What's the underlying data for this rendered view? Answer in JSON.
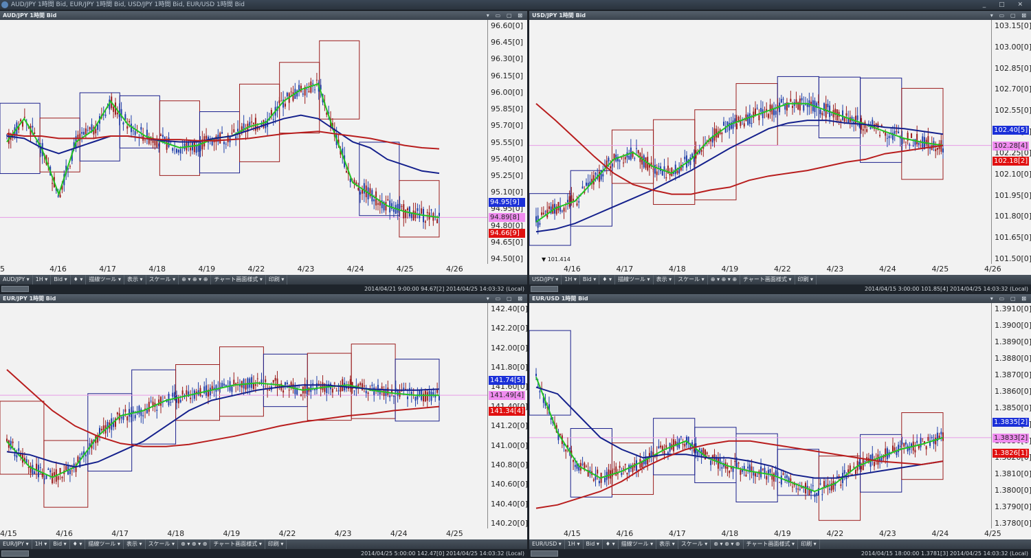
{
  "app": {
    "title": "AUD/JPY 1時間 Bid, EUR/JPY 1時間 Bid, USD/JPY 1時間 Bid, EUR/USD 1時間 Bid",
    "controls": "_ □ ✕"
  },
  "colors": {
    "plot_bg": "#f2f2f2",
    "candle_up": "#1f3fa8",
    "candle_down": "#9b1c1c",
    "ma_short": "#22c322",
    "ma_mid": "#14208c",
    "ma_long": "#b81d1d",
    "box_up": "#1a1f8c",
    "box_down": "#9b1c1c",
    "bid_line": "#e79be7",
    "tag_high": "#1a2fd8",
    "tag_mid": "#f08cf0",
    "tag_low": "#e01010"
  },
  "toolbar_items": [
    "1H ▾",
    "Bid ▾",
    "♦ ▾",
    "描線ツール ▾",
    "表示 ▾",
    "スケール ▾",
    "⊕ ▾ ⊕ ▾ ⊕",
    "チャート画面様式 ▾",
    "印刷 ▾"
  ],
  "panes": [
    {
      "id": "audjpy",
      "title": "AUD/JPY 1時間 Bid",
      "symbol": "AUD/JPY ▾",
      "y_ticks": [
        "96.60[0]",
        "96.45[0]",
        "96.30[0]",
        "96.15[0]",
        "96.00[0]",
        "95.85[0]",
        "95.70[0]",
        "95.55[0]",
        "95.40[0]",
        "95.25[0]",
        "95.10[0]",
        "94.95[0]",
        "94.80[0]",
        "94.65[0]",
        "94.50[0]"
      ],
      "x_ticks": [
        "5",
        "4/16",
        "4/17",
        "4/18",
        "4/19",
        "4/22",
        "4/23",
        "4/24",
        "4/25",
        "4/26"
      ],
      "tags": [
        "94.95[9]",
        "94.89[8]",
        "94.66[9]"
      ],
      "status": "2014/04/21 9:00:00   94.67[2]   2014/04/25 14:03:32 (Local)",
      "chart_data": {
        "type": "line",
        "ylim": [
          94.5,
          96.6
        ],
        "series": [
          {
            "values": [
              95.55,
              95.75,
              95.5,
              95.1,
              95.55,
              95.65,
              95.9,
              95.7,
              95.6,
              95.55,
              95.5,
              95.52,
              95.58,
              95.6,
              95.68,
              95.72,
              95.9,
              96.0,
              96.05,
              95.6,
              95.2,
              95.1,
              95.0,
              94.95,
              94.92,
              94.9
            ]
          },
          {
            "values": [
              95.6,
              95.58,
              95.5,
              95.45,
              95.5,
              95.55,
              95.6,
              95.6,
              95.58,
              95.56,
              95.55,
              95.55,
              95.58,
              95.6,
              95.65,
              95.7,
              95.75,
              95.78,
              95.75,
              95.65,
              95.55,
              95.5,
              95.4,
              95.35,
              95.3,
              95.28
            ]
          },
          {
            "values": [
              95.62,
              95.6,
              95.6,
              95.58,
              95.58,
              95.58,
              95.6,
              95.6,
              95.58,
              95.57,
              95.57,
              95.56,
              95.56,
              95.57,
              95.58,
              95.6,
              95.62,
              95.63,
              95.64,
              95.62,
              95.6,
              95.58,
              95.55,
              95.52,
              95.5,
              95.49
            ]
          }
        ]
      }
    },
    {
      "id": "usdjpy",
      "title": "USD/JPY 1時間 Bid",
      "symbol": "USD/JPY ▾",
      "y_ticks": [
        "103.15[0]",
        "103.00[0]",
        "102.85[0]",
        "102.70[0]",
        "102.55[0]",
        "102.40[0]",
        "102.25[0]",
        "102.10[0]",
        "101.95[0]",
        "101.80[0]",
        "101.65[0]",
        "101.50[0]"
      ],
      "x_ticks": [
        "4/16",
        "4/17",
        "4/18",
        "4/19",
        "4/22",
        "4/23",
        "4/24",
        "4/25",
        "4/26"
      ],
      "tags": [
        "102.40[5]",
        "102.28[4]",
        "102.18[2]"
      ],
      "low_marker": "▼ 101.414",
      "status": "2014/04/15 3:00:00   101.85[4]   2014/04/25 14:03:32 (Local)",
      "chart_data": {
        "type": "line",
        "ylim": [
          101.45,
          103.2
        ],
        "series": [
          {
            "values": [
              101.75,
              101.85,
              101.9,
              102.05,
              102.2,
              102.25,
              102.15,
              102.1,
              102.2,
              102.35,
              102.45,
              102.5,
              102.55,
              102.6,
              102.6,
              102.55,
              102.5,
              102.45,
              102.4,
              102.35,
              102.32,
              102.3
            ]
          },
          {
            "values": [
              101.68,
              101.7,
              101.74,
              101.8,
              101.86,
              101.92,
              101.98,
              102.05,
              102.12,
              102.2,
              102.28,
              102.35,
              102.42,
              102.46,
              102.48,
              102.48,
              102.46,
              102.45,
              102.43,
              102.42,
              102.4,
              102.38
            ]
          },
          {
            "values": [
              102.6,
              102.48,
              102.35,
              102.22,
              102.1,
              102.02,
              101.98,
              101.95,
              101.95,
              101.98,
              102.0,
              102.05,
              102.08,
              102.1,
              102.12,
              102.15,
              102.18,
              102.2,
              102.24,
              102.26,
              102.28,
              102.3
            ]
          }
        ]
      }
    },
    {
      "id": "eurjpy",
      "title": "EUR/JPY 1時間 Bid",
      "symbol": "EUR/JPY ▾",
      "y_ticks": [
        "142.40[0]",
        "142.20[0]",
        "142.00[0]",
        "141.80[0]",
        "141.60[0]",
        "141.40[0]",
        "141.20[0]",
        "141.00[0]",
        "140.80[0]",
        "140.60[0]",
        "140.40[0]",
        "140.20[0]"
      ],
      "x_ticks": [
        "4/15",
        "4/16",
        "4/17",
        "4/18",
        "4/19",
        "4/22",
        "4/23",
        "4/24",
        "4/25"
      ],
      "tags": [
        "141.74[5]",
        "141.49[4]",
        "141.34[4]"
      ],
      "status": "2014/04/25 5:00:00   142.47[0]   2014/04/25 14:03:32 (Local)",
      "chart_data": {
        "type": "line",
        "ylim": [
          140.2,
          142.4
        ],
        "series": [
          {
            "values": [
              141.05,
              140.8,
              140.7,
              140.8,
              141.1,
              141.3,
              141.35,
              141.45,
              141.5,
              141.55,
              141.6,
              141.62,
              141.6,
              141.55,
              141.58,
              141.6,
              141.55,
              141.52,
              141.5,
              141.5
            ]
          },
          {
            "values": [
              140.95,
              140.92,
              140.85,
              140.8,
              140.85,
              140.95,
              141.05,
              141.2,
              141.35,
              141.45,
              141.5,
              141.55,
              141.58,
              141.6,
              141.6,
              141.58,
              141.56,
              141.55,
              141.55,
              141.56
            ]
          },
          {
            "values": [
              141.75,
              141.55,
              141.35,
              141.2,
              141.1,
              141.03,
              141.0,
              141.0,
              141.02,
              141.06,
              141.1,
              141.15,
              141.2,
              141.24,
              141.27,
              141.3,
              141.32,
              141.35,
              141.37,
              141.39
            ]
          }
        ]
      }
    },
    {
      "id": "eurusd",
      "title": "EUR/USD 1時間 Bid",
      "symbol": "EUR/USD ▾",
      "y_ticks": [
        "1.3910[0]",
        "1.3900[0]",
        "1.3890[0]",
        "1.3880[0]",
        "1.3870[0]",
        "1.3860[0]",
        "1.3850[0]",
        "1.3840[0]",
        "1.3830[0]",
        "1.3820[0]",
        "1.3810[0]",
        "1.3800[0]",
        "1.3790[0]",
        "1.3780[0]"
      ],
      "x_ticks": [
        "4/15",
        "4/16",
        "4/17",
        "4/18",
        "4/19",
        "4/22",
        "4/23",
        "4/24",
        "4/25"
      ],
      "tags": [
        "1.3835[2]",
        "1.3833[2]",
        "1.3826[1]"
      ],
      "status": "2014/04/15 18:00:00   1.3781[3]   2014/04/25 14:03:32 (Local)",
      "chart_data": {
        "type": "line",
        "ylim": [
          1.3778,
          1.3912
        ],
        "series": [
          {
            "values": [
              1.3868,
              1.3835,
              1.3815,
              1.3808,
              1.3812,
              1.3818,
              1.3825,
              1.383,
              1.382,
              1.3815,
              1.3812,
              1.381,
              1.3805,
              1.38,
              1.3805,
              1.3815,
              1.382,
              1.3825,
              1.3828,
              1.3832
            ]
          },
          {
            "values": [
              1.3862,
              1.3858,
              1.3845,
              1.3832,
              1.3825,
              1.382,
              1.3822,
              1.3822,
              1.382,
              1.382,
              1.3818,
              1.3815,
              1.381,
              1.3808,
              1.3808,
              1.381,
              1.3812,
              1.3814,
              1.3816,
              1.3818
            ]
          },
          {
            "values": [
              1.379,
              1.3792,
              1.3796,
              1.38,
              1.3806,
              1.3814,
              1.382,
              1.3825,
              1.3828,
              1.383,
              1.383,
              1.3828,
              1.3826,
              1.3824,
              1.3822,
              1.382,
              1.3818,
              1.3817,
              1.3816,
              1.3818
            ]
          }
        ]
      }
    }
  ]
}
